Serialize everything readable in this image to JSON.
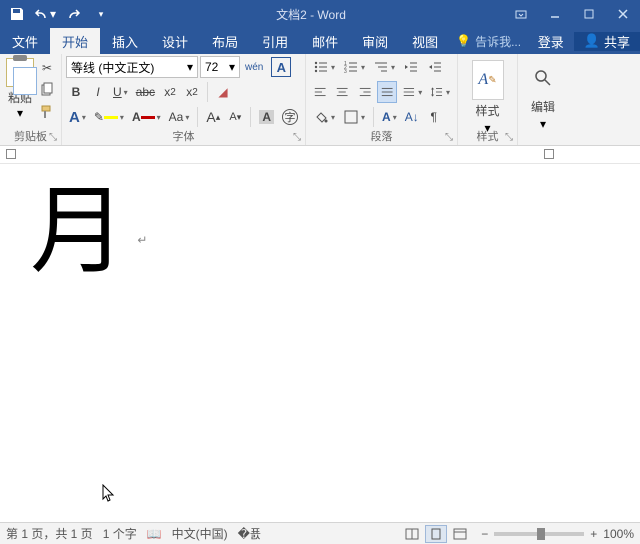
{
  "title": "文档2 - Word",
  "tabs": {
    "file": "文件",
    "home": "开始",
    "insert": "插入",
    "design": "设计",
    "layout": "布局",
    "references": "引用",
    "mailings": "邮件",
    "review": "审阅",
    "view": "视图"
  },
  "tellme": "告诉我...",
  "login": "登录",
  "share": "共享",
  "clipboard": {
    "paste": "粘贴",
    "group": "剪贴板"
  },
  "font": {
    "name": "等线 (中文正文)",
    "size": "72",
    "bold": "B",
    "italic": "I",
    "underline": "U",
    "strike": "abc",
    "sub": "x",
    "sup": "x",
    "bigA": "A",
    "smallA": "A",
    "clear": "A",
    "phonetic": "wén",
    "charborder": "A",
    "case": "Aa",
    "grow": "A",
    "shrink": "A",
    "group": "字体"
  },
  "paragraph": {
    "group": "段落"
  },
  "styles": {
    "label": "样式",
    "group": "样式",
    "sample": "A"
  },
  "editing": {
    "label": "编辑"
  },
  "document_text": "月",
  "para_mark": "↵",
  "status": {
    "page": "第 1 页，共 1 页",
    "words": "1 个字",
    "lang": "中文(中国)",
    "zoom": "100%"
  }
}
